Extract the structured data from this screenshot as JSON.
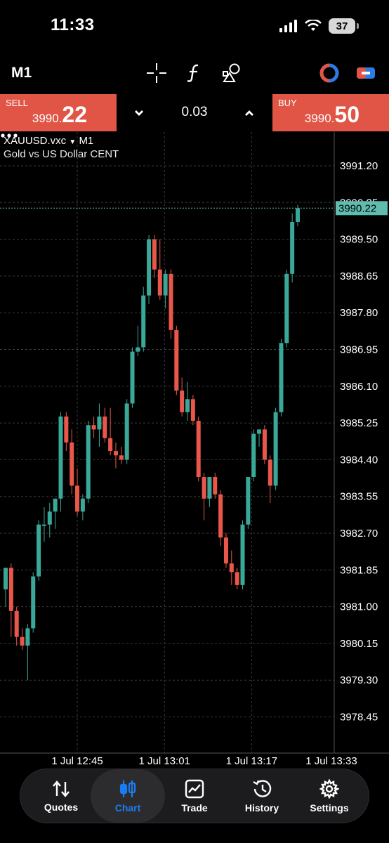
{
  "status_bar": {
    "time": "11:33",
    "battery": "37"
  },
  "toolbar": {
    "timeframe": "M1",
    "tools": [
      "crosshair-icon",
      "indicators-icon",
      "objects-icon"
    ],
    "right_icons": [
      "one-click-trading-icon",
      "trade-toggle-icon"
    ]
  },
  "trade": {
    "sell_label": "SELL",
    "sell_price_prefix": "3990.",
    "sell_price_big": "22",
    "buy_label": "BUY",
    "buy_price_prefix": "3990.",
    "buy_price_big": "50",
    "volume": "0.03",
    "decrease_symbol": "⌄",
    "increase_symbol": "⌃"
  },
  "chart": {
    "symbol": "XAUUSD.vxc",
    "timeframe": "M1",
    "description": "Gold vs US Dollar CENT",
    "current_price": "3990.22",
    "y_ticks": [
      "3991.20",
      "3990.35",
      "3989.50",
      "3988.65",
      "3987.80",
      "3986.95",
      "3986.10",
      "3985.25",
      "3984.40",
      "3983.55",
      "3982.70",
      "3981.85",
      "3981.00",
      "3980.15",
      "3979.30",
      "3978.45"
    ],
    "x_ticks": [
      "1 Jul 12:45",
      "1 Jul 13:01",
      "1 Jul 13:17",
      "1 Jul 13:33"
    ],
    "colors": {
      "bull": "#3aa898",
      "bear": "#e8574a",
      "grid": "#3a3a3a",
      "price_line": "#5fbcae"
    }
  },
  "chart_data": {
    "type": "candlestick",
    "title": "XAUUSD.vxc M1",
    "ylim": [
      3978.0,
      3991.6
    ],
    "candles": [
      {
        "o": 3981.4,
        "h": 3981.9,
        "l": 3981.0,
        "c": 3981.9
      },
      {
        "o": 3981.9,
        "h": 3982.0,
        "l": 3980.3,
        "c": 3980.9
      },
      {
        "o": 3980.9,
        "h": 3981.0,
        "l": 3980.1,
        "c": 3980.3
      },
      {
        "o": 3980.3,
        "h": 3980.5,
        "l": 3980.0,
        "c": 3980.1
      },
      {
        "o": 3980.1,
        "h": 3980.6,
        "l": 3979.3,
        "c": 3980.5
      },
      {
        "o": 3980.5,
        "h": 3981.8,
        "l": 3980.4,
        "c": 3981.7
      },
      {
        "o": 3981.7,
        "h": 3983.0,
        "l": 3981.6,
        "c": 3982.9
      },
      {
        "o": 3982.9,
        "h": 3983.3,
        "l": 3982.5,
        "c": 3982.9
      },
      {
        "o": 3982.9,
        "h": 3983.4,
        "l": 3982.6,
        "c": 3983.2
      },
      {
        "o": 3983.2,
        "h": 3983.5,
        "l": 3982.8,
        "c": 3983.5
      },
      {
        "o": 3983.5,
        "h": 3985.5,
        "l": 3983.2,
        "c": 3985.4
      },
      {
        "o": 3985.4,
        "h": 3985.5,
        "l": 3984.6,
        "c": 3984.8
      },
      {
        "o": 3984.8,
        "h": 3985.1,
        "l": 3983.6,
        "c": 3983.8
      },
      {
        "o": 3983.8,
        "h": 3984.2,
        "l": 3983.1,
        "c": 3983.2
      },
      {
        "o": 3983.2,
        "h": 3983.6,
        "l": 3983.0,
        "c": 3983.5
      },
      {
        "o": 3983.5,
        "h": 3985.3,
        "l": 3983.4,
        "c": 3985.2
      },
      {
        "o": 3985.2,
        "h": 3985.4,
        "l": 3984.9,
        "c": 3985.1
      },
      {
        "o": 3985.1,
        "h": 3985.7,
        "l": 3984.7,
        "c": 3985.4
      },
      {
        "o": 3985.4,
        "h": 3985.6,
        "l": 3984.8,
        "c": 3984.9
      },
      {
        "o": 3984.9,
        "h": 3985.6,
        "l": 3984.5,
        "c": 3984.6
      },
      {
        "o": 3984.6,
        "h": 3984.8,
        "l": 3984.2,
        "c": 3984.5
      },
      {
        "o": 3984.5,
        "h": 3984.7,
        "l": 3984.3,
        "c": 3984.4
      },
      {
        "o": 3984.4,
        "h": 3985.8,
        "l": 3984.3,
        "c": 3985.7
      },
      {
        "o": 3985.7,
        "h": 3987.0,
        "l": 3985.6,
        "c": 3986.9
      },
      {
        "o": 3986.9,
        "h": 3987.5,
        "l": 3986.8,
        "c": 3987.0
      },
      {
        "o": 3987.0,
        "h": 3988.4,
        "l": 3986.9,
        "c": 3988.2
      },
      {
        "o": 3988.2,
        "h": 3989.6,
        "l": 3988.0,
        "c": 3989.5
      },
      {
        "o": 3989.5,
        "h": 3989.6,
        "l": 3988.6,
        "c": 3988.8
      },
      {
        "o": 3988.8,
        "h": 3989.5,
        "l": 3988.1,
        "c": 3988.2
      },
      {
        "o": 3988.2,
        "h": 3988.8,
        "l": 3987.9,
        "c": 3988.7
      },
      {
        "o": 3988.7,
        "h": 3988.8,
        "l": 3987.2,
        "c": 3987.4
      },
      {
        "o": 3987.4,
        "h": 3987.5,
        "l": 3985.9,
        "c": 3986.0
      },
      {
        "o": 3986.0,
        "h": 3986.3,
        "l": 3985.4,
        "c": 3985.5
      },
      {
        "o": 3985.5,
        "h": 3986.2,
        "l": 3985.3,
        "c": 3985.8
      },
      {
        "o": 3985.8,
        "h": 3985.9,
        "l": 3985.2,
        "c": 3985.3
      },
      {
        "o": 3985.3,
        "h": 3985.4,
        "l": 3983.9,
        "c": 3984.0
      },
      {
        "o": 3984.0,
        "h": 3984.1,
        "l": 3983.0,
        "c": 3983.5
      },
      {
        "o": 3983.5,
        "h": 3984.0,
        "l": 3983.3,
        "c": 3984.0
      },
      {
        "o": 3984.0,
        "h": 3984.1,
        "l": 3983.5,
        "c": 3983.6
      },
      {
        "o": 3983.6,
        "h": 3983.7,
        "l": 3982.4,
        "c": 3982.6
      },
      {
        "o": 3982.6,
        "h": 3982.7,
        "l": 3981.9,
        "c": 3982.0
      },
      {
        "o": 3982.0,
        "h": 3982.3,
        "l": 3981.5,
        "c": 3981.8
      },
      {
        "o": 3981.8,
        "h": 3981.9,
        "l": 3981.4,
        "c": 3981.5
      },
      {
        "o": 3981.5,
        "h": 3983.0,
        "l": 3981.4,
        "c": 3982.9
      },
      {
        "o": 3982.9,
        "h": 3984.0,
        "l": 3982.8,
        "c": 3984.0
      },
      {
        "o": 3984.0,
        "h": 3985.1,
        "l": 3983.9,
        "c": 3985.0
      },
      {
        "o": 3985.0,
        "h": 3985.1,
        "l": 3984.7,
        "c": 3985.1
      },
      {
        "o": 3985.1,
        "h": 3985.2,
        "l": 3984.3,
        "c": 3984.4
      },
      {
        "o": 3984.4,
        "h": 3984.5,
        "l": 3983.4,
        "c": 3983.8
      },
      {
        "o": 3983.8,
        "h": 3985.6,
        "l": 3983.7,
        "c": 3985.5
      },
      {
        "o": 3985.5,
        "h": 3987.2,
        "l": 3985.4,
        "c": 3987.1
      },
      {
        "o": 3987.1,
        "h": 3988.8,
        "l": 3987.0,
        "c": 3988.7
      },
      {
        "o": 3988.7,
        "h": 3990.1,
        "l": 3988.5,
        "c": 3989.9
      },
      {
        "o": 3989.9,
        "h": 3990.3,
        "l": 3989.8,
        "c": 3990.22
      }
    ]
  },
  "tabs": [
    {
      "label": "Quotes",
      "icon": "quotes-icon",
      "active": false
    },
    {
      "label": "Chart",
      "icon": "chart-icon",
      "active": true
    },
    {
      "label": "Trade",
      "icon": "trade-icon",
      "active": false
    },
    {
      "label": "History",
      "icon": "history-icon",
      "active": false
    },
    {
      "label": "Settings",
      "icon": "settings-icon",
      "active": false
    }
  ]
}
